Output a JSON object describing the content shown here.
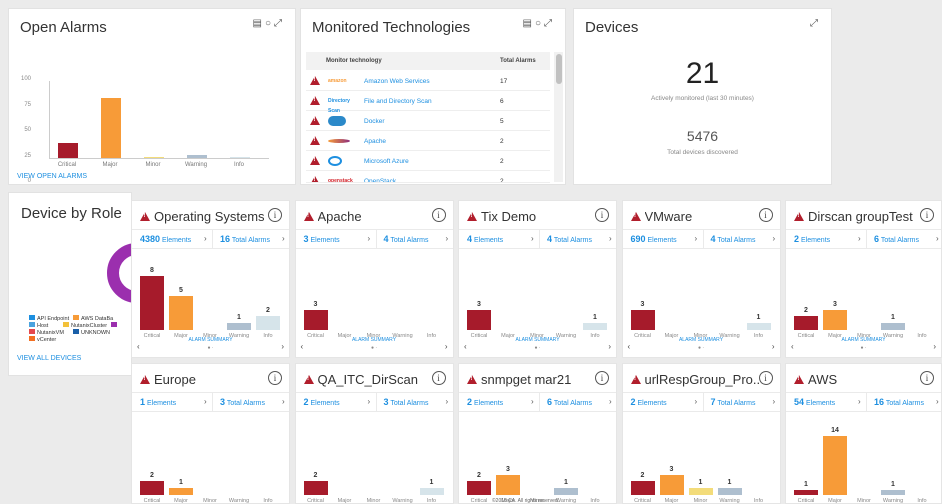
{
  "colors": {
    "critical": "#a61b2b",
    "major": "#f79b38",
    "minor": "#f3dc7a",
    "warning": "#aebfcf",
    "info": "#d6e4ea",
    "link": "#1d8fe0"
  },
  "open_alarms": {
    "title": "Open Alarms",
    "link": "VIEW OPEN ALARMS",
    "chart_data": {
      "type": "bar",
      "categories": [
        "Critical",
        "Major",
        "Minor",
        "Warning",
        "Info"
      ],
      "values": [
        19,
        77,
        0,
        4,
        1
      ],
      "yticks": [
        "100",
        "75",
        "50",
        "25",
        "0"
      ],
      "ylim": [
        0,
        100
      ]
    }
  },
  "monitored": {
    "title": "Monitored Technologies",
    "col_tech": "Monitor technology",
    "col_alarms": "Total Alarms",
    "rows": [
      {
        "logo": "amazon",
        "logo_text": "amazon",
        "name": "Amazon Web Services",
        "alarms": "17"
      },
      {
        "logo": "directory",
        "logo_text": "Directory Scan",
        "name": "File and Directory Scan",
        "alarms": "6"
      },
      {
        "logo": "docker",
        "logo_text": "",
        "name": "Docker",
        "alarms": "5"
      },
      {
        "logo": "apache",
        "logo_text": "",
        "name": "Apache",
        "alarms": "2"
      },
      {
        "logo": "azure",
        "logo_text": "",
        "name": "Microsoft Azure",
        "alarms": "2"
      },
      {
        "logo": "openstack",
        "logo_text": "openstack",
        "name": "OpenStack",
        "alarms": "2"
      }
    ]
  },
  "devices": {
    "title": "Devices",
    "count": "21",
    "count_label": "Actively monitored (last 30 minutes)",
    "discovered": "5476",
    "discovered_label": "Total devices discovered"
  },
  "device_role": {
    "title": "Device by Role",
    "link": "VIEW ALL DEVICES",
    "legend": [
      {
        "label": "API Endpoint",
        "color": "#1d8fe0"
      },
      {
        "label": "AWS DataBa",
        "color": "#f79b38"
      },
      {
        "label": "Host",
        "color": "#4aa3df"
      },
      {
        "label": "NutanixCluster",
        "color": "#f3c13a"
      },
      {
        "label": "",
        "color": "#9b2fae"
      },
      {
        "label": "NutanixVM",
        "color": "#e5484d"
      },
      {
        "label": "UNKNOWN",
        "color": "#1a5fa8"
      },
      {
        "label": "vCenter",
        "color": "#f36f21"
      }
    ]
  },
  "tiles": [
    {
      "title": "Operating Systems",
      "elements": "4380",
      "alarms": "16",
      "el_label": "Elements",
      "al_label": "Total Alarms",
      "values": [
        8,
        5,
        0,
        1,
        2
      ],
      "summary": "ALARM SUMMARY"
    },
    {
      "title": "Apache",
      "elements": "3",
      "alarms": "4",
      "el_label": "Elements",
      "al_label": "Total Alarms",
      "values": [
        3,
        0,
        0,
        0,
        0
      ],
      "summary": "ALARM SUMMARY"
    },
    {
      "title": "Tix Demo",
      "elements": "4",
      "alarms": "4",
      "el_label": "Elements",
      "al_label": "Total Alarms",
      "values": [
        3,
        0,
        0,
        0,
        1
      ],
      "summary": "ALARM SUMMARY"
    },
    {
      "title": "VMware",
      "elements": "690",
      "alarms": "4",
      "el_label": "Elements",
      "al_label": "Total Alarms",
      "values": [
        3,
        0,
        0,
        0,
        1
      ],
      "summary": "ALARM SUMMARY"
    },
    {
      "title": "Dirscan groupTest",
      "elements": "2",
      "alarms": "6",
      "el_label": "Elements",
      "al_label": "Total Alarms",
      "values": [
        2,
        3,
        0,
        1,
        0
      ],
      "summary": "ALARM SUMMARY"
    },
    {
      "title": "Europe",
      "elements": "1",
      "alarms": "3",
      "el_label": "Elements",
      "al_label": "Total Alarms",
      "values": [
        2,
        1,
        0,
        0,
        0
      ],
      "summary": ""
    },
    {
      "title": "QA_ITC_DirScan",
      "elements": "2",
      "alarms": "3",
      "el_label": "Elements",
      "al_label": "Total Alarms",
      "values": [
        2,
        0,
        0,
        0,
        1
      ],
      "summary": ""
    },
    {
      "title": "snmpget mar21",
      "elements": "2",
      "alarms": "6",
      "el_label": "Elements",
      "al_label": "Total Alarms",
      "values": [
        2,
        3,
        0,
        1,
        0
      ],
      "summary": ""
    },
    {
      "title": "urlRespGroup_Pro...",
      "elements": "2",
      "alarms": "7",
      "el_label": "Elements",
      "al_label": "Total Alarms",
      "values": [
        2,
        3,
        1,
        1,
        0
      ],
      "summary": ""
    },
    {
      "title": "AWS",
      "elements": "54",
      "alarms": "16",
      "el_label": "Elements",
      "al_label": "Total Alarms",
      "values": [
        1,
        14,
        0,
        1,
        0
      ],
      "summary": ""
    }
  ],
  "categories": [
    "Critical",
    "Major",
    "Minor",
    "Warning",
    "Info"
  ],
  "footer": "©2018 CA. All rights reserved."
}
